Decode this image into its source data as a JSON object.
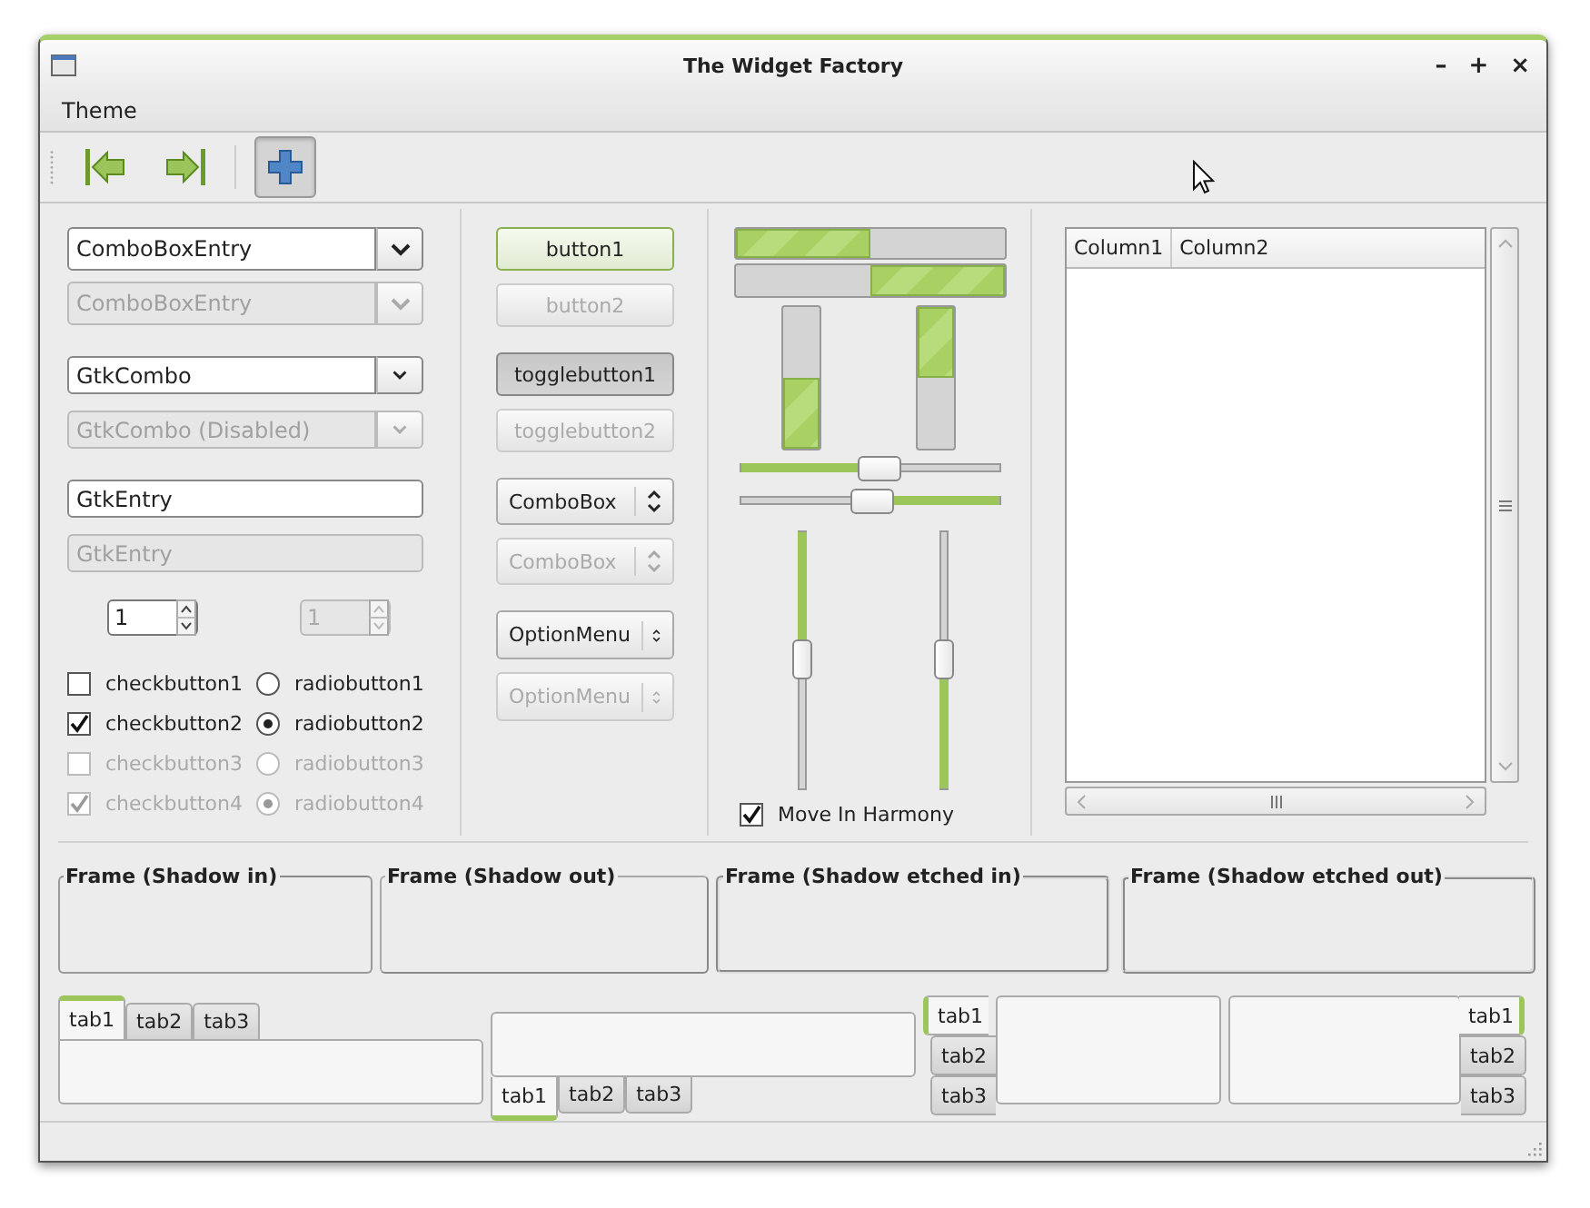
{
  "window": {
    "title": "The Widget Factory",
    "controls": [
      "–",
      "+",
      "×"
    ]
  },
  "menu": [
    {
      "label": "Theme"
    }
  ],
  "toolbar": [
    {
      "kind": "first",
      "active": false
    },
    {
      "kind": "last",
      "active": false
    },
    {
      "kind": "separator"
    },
    {
      "kind": "add",
      "active": true
    }
  ],
  "fields": [
    {
      "kind": "combo-entry",
      "value": "ComboBoxEntry",
      "disabled": false
    },
    {
      "kind": "combo-entry",
      "value": "ComboBoxEntry",
      "disabled": true
    },
    {
      "kind": "combo",
      "value": "GtkCombo",
      "disabled": false
    },
    {
      "kind": "combo",
      "value": "GtkCombo (Disabled)",
      "disabled": true
    },
    {
      "kind": "entry",
      "value": "GtkEntry",
      "disabled": false
    },
    {
      "kind": "entry",
      "value": "GtkEntry",
      "disabled": true
    }
  ],
  "spin_buttons": [
    {
      "value": "1",
      "disabled": false
    },
    {
      "value": "1",
      "disabled": true
    }
  ],
  "check_buttons": [
    {
      "label": "checkbutton1",
      "checked": false,
      "disabled": false
    },
    {
      "label": "checkbutton2",
      "checked": true,
      "disabled": false
    },
    {
      "label": "checkbutton3",
      "checked": false,
      "disabled": true
    },
    {
      "label": "checkbutton4",
      "checked": true,
      "disabled": true
    }
  ],
  "radio_buttons": [
    {
      "label": "radiobutton1",
      "selected": false,
      "disabled": false
    },
    {
      "label": "radiobutton2",
      "selected": true,
      "disabled": false
    },
    {
      "label": "radiobutton3",
      "selected": false,
      "disabled": true
    },
    {
      "label": "radiobutton4",
      "selected": true,
      "disabled": true
    }
  ],
  "buttons": [
    {
      "kind": "button",
      "label": "button1",
      "disabled": false,
      "focused": true,
      "pressed": false
    },
    {
      "kind": "button",
      "label": "button2",
      "disabled": true,
      "focused": false,
      "pressed": false
    },
    {
      "kind": "toggle",
      "label": "togglebutton1",
      "disabled": false,
      "focused": false,
      "pressed": true
    },
    {
      "kind": "toggle",
      "label": "togglebutton2",
      "disabled": true,
      "focused": false,
      "pressed": false
    },
    {
      "kind": "combo",
      "label": "ComboBox",
      "disabled": false,
      "focused": false,
      "pressed": false
    },
    {
      "kind": "combo",
      "label": "ComboBox",
      "disabled": true,
      "focused": false,
      "pressed": false
    },
    {
      "kind": "option",
      "label": "OptionMenu",
      "disabled": false,
      "focused": false,
      "pressed": false
    },
    {
      "kind": "option",
      "label": "OptionMenu",
      "disabled": true,
      "focused": false,
      "pressed": false
    }
  ],
  "horizontal_progress_bars": [
    {
      "inverted": false,
      "level": 0.5
    },
    {
      "inverted": true,
      "level": 0.5
    }
  ],
  "vertical_progress_bars": [
    {
      "inverted": false,
      "level": 0.5
    },
    {
      "inverted": true,
      "level": 0.5
    }
  ],
  "horizontal_scales": [
    {
      "inverted": false,
      "level": 0.53
    },
    {
      "inverted": true,
      "level": 0.5
    }
  ],
  "vertical_scales": [
    {
      "inverted": false,
      "level": 0.5
    },
    {
      "inverted": true,
      "level": 0.5
    }
  ],
  "harmony": {
    "label": "Move In Harmony",
    "checked": true
  },
  "tree": {
    "columns": [
      "Column1",
      "Column2"
    ]
  },
  "frames": [
    {
      "label": "Frame (Shadow in)",
      "kind": "in"
    },
    {
      "label": "Frame (Shadow out)",
      "kind": "out"
    },
    {
      "label": "Frame (Shadow etched in)",
      "kind": "etched-in"
    },
    {
      "label": "Frame (Shadow etched out)",
      "kind": "etched-out"
    }
  ],
  "notebooks": [
    {
      "kind": "top",
      "tabs": [
        {
          "label": "tab1",
          "selected": true
        },
        {
          "label": "tab2",
          "selected": false
        },
        {
          "label": "tab3",
          "selected": false
        }
      ]
    },
    {
      "kind": "bottom",
      "tabs": [
        {
          "label": "tab1",
          "selected": true
        },
        {
          "label": "tab2",
          "selected": false
        },
        {
          "label": "tab3",
          "selected": false
        }
      ]
    },
    {
      "kind": "left",
      "tabs": [
        {
          "label": "tab1",
          "selected": true
        },
        {
          "label": "tab2",
          "selected": false
        },
        {
          "label": "tab3",
          "selected": false
        }
      ]
    },
    {
      "kind": "right",
      "tabs": [
        {
          "label": "tab1",
          "selected": true
        },
        {
          "label": "tab2",
          "selected": false
        },
        {
          "label": "tab3",
          "selected": false
        }
      ]
    }
  ]
}
